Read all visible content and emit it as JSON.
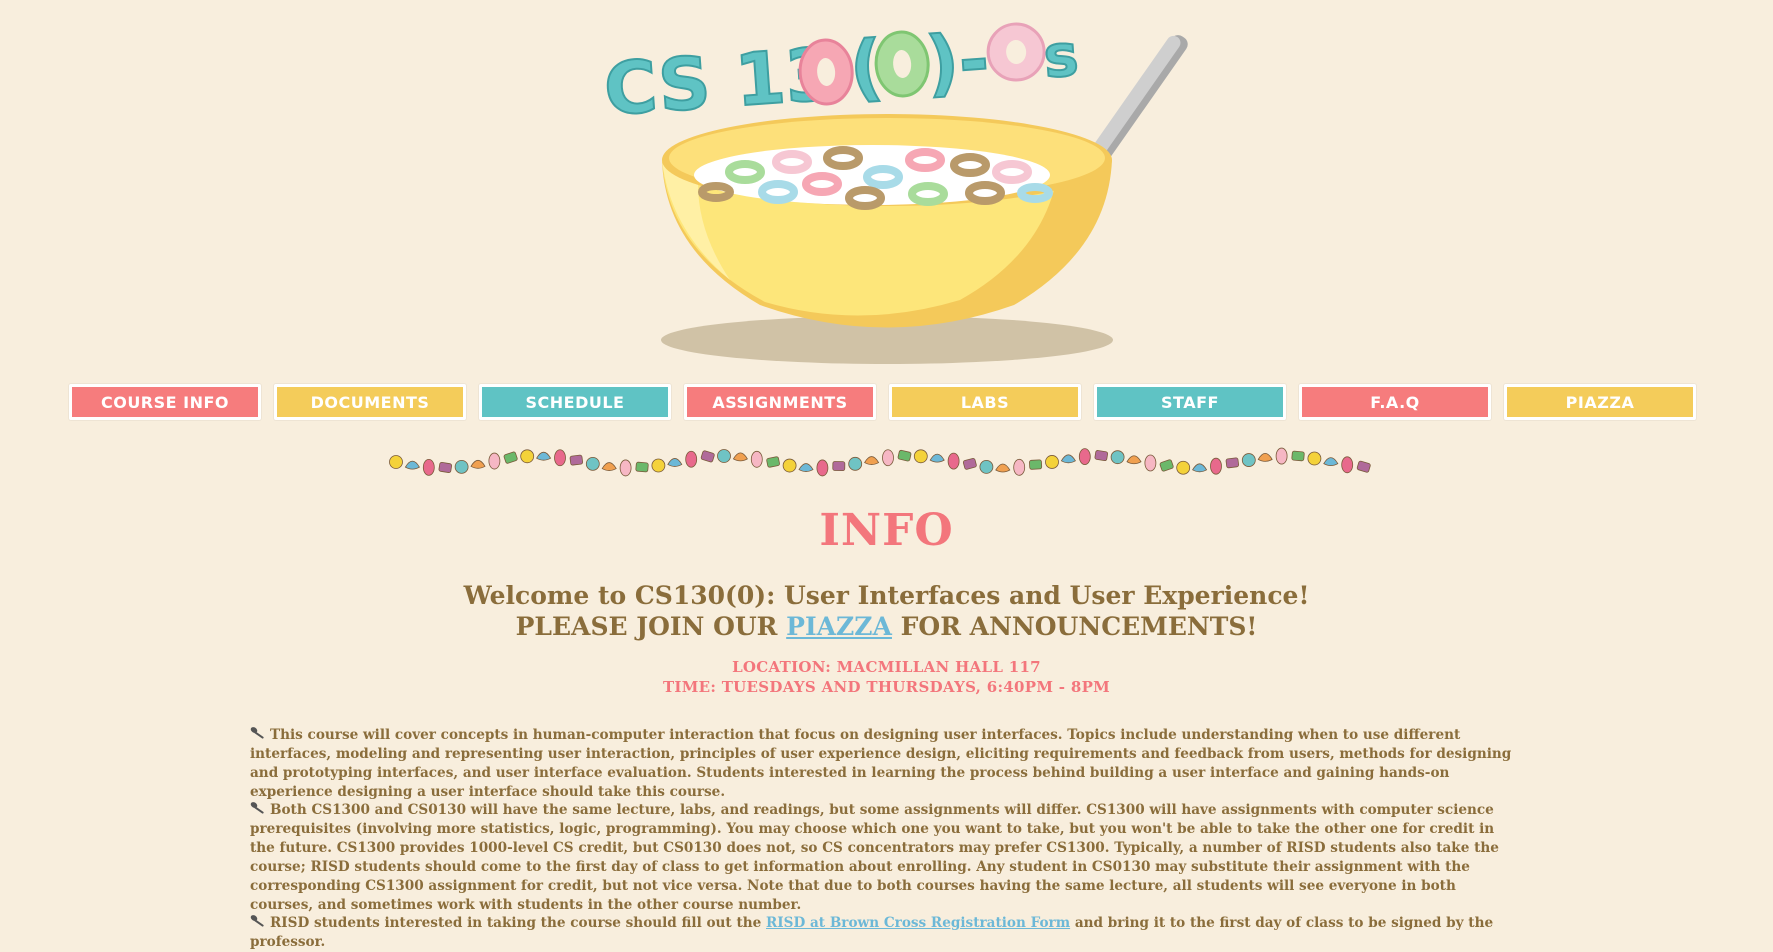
{
  "logo": {
    "title_main": "CS 13",
    "title_rest_1": "(",
    "title_rest_2": ")-",
    "title_suffix": "s",
    "colors": {
      "teal": "#5fc3c4",
      "pink": "#f6a7b4",
      "green": "#a9dc9b",
      "lightpink": "#f6c7d3",
      "bowl": "#fde67a",
      "bowl_dark": "#f4c95a",
      "shadow": "#d0c2a6"
    }
  },
  "nav": {
    "items": [
      {
        "label": "COURSE INFO",
        "color": "pink"
      },
      {
        "label": "DOCUMENTS",
        "color": "yellow"
      },
      {
        "label": "SCHEDULE",
        "color": "teal"
      },
      {
        "label": "ASSIGNMENTS",
        "color": "pink"
      },
      {
        "label": "LABS",
        "color": "yellow"
      },
      {
        "label": "STAFF",
        "color": "teal"
      },
      {
        "label": "F.A.Q",
        "color": "pink"
      },
      {
        "label": "PIAZZA",
        "color": "yellow"
      }
    ]
  },
  "content": {
    "section_title": "INFO",
    "welcome_line1": "Welcome to CS130(0): User Interfaces and User Experience!",
    "welcome_line2_prefix": "PLEASE JOIN OUR ",
    "welcome_link": "PIAZZA",
    "welcome_line2_suffix": " FOR ANNOUNCEMENTS!",
    "location": "LOCATION: MACMILLAN HALL 117",
    "time": "TIME: TUESDAYS AND THURSDAYS, 6:40PM - 8PM",
    "para1": "This course will cover concepts in human-computer interaction that focus on designing user interfaces. Topics include understanding when to use different interfaces, modeling and representing user interaction, principles of user experience design, eliciting requirements and feedback from users, methods for designing and prototyping interfaces, and user interface evaluation. Students interested in learning the process behind building a user interface and gaining hands-on experience designing a user interface should take this course.",
    "para2": "Both CS1300 and CS0130 will have the same lecture, labs, and readings, but some assignments will differ. CS1300 will have assignments with computer science prerequisites (involving more statistics, logic, programming). You may choose which one you want to take, but you won't be able to take the other one for credit in the future. CS1300 provides 1000-level CS credit, but CS0130 does not, so CS concentrators may prefer CS1300. Typically, a number of RISD students also take the course; RISD students should come to the first day of class to get information about enrolling. Any student in CS0130 may substitute their assignment with the corresponding CS1300 assignment for credit, but not vice versa. Note that due to both courses having the same lecture, all students will see everyone in both courses, and sometimes work with students in the other course number.",
    "para3_prefix": "RISD students interested in taking the course should fill out the ",
    "para3_link": "RISD at Brown Cross Registration Form",
    "para3_suffix": " and bring it to the first day of class to be signed by the professor.",
    "bullet_icon": "spoon-icon"
  }
}
